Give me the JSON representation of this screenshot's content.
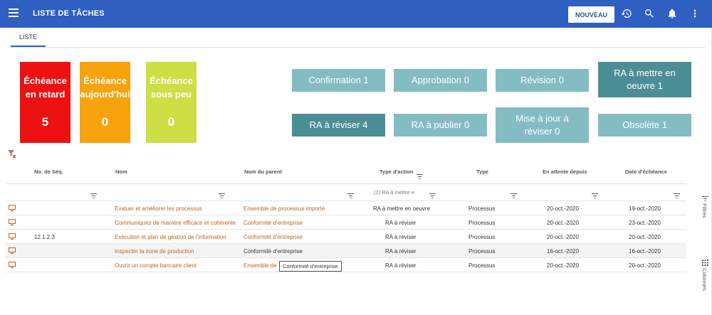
{
  "header": {
    "title": "LISTE DE TÂCHES",
    "new_label": "NOUVEAU"
  },
  "tabs": [
    {
      "label": "LISTE"
    }
  ],
  "tiles": [
    {
      "label": "Échéance en retard",
      "count": "5",
      "color": "#ee1111"
    },
    {
      "label": "Échéance aujourd'hui",
      "count": "0",
      "color": "#f8a20e"
    },
    {
      "label": "Échéance sous peu",
      "count": "0",
      "color": "#cede45"
    }
  ],
  "status_buttons": [
    {
      "label": "Confirmation 1",
      "color": "#84bcc4"
    },
    {
      "label": "Approbation 0",
      "color": "#84bcc4"
    },
    {
      "label": "Révision 0",
      "color": "#84bcc4"
    },
    {
      "label": "RA à mettre en oeuvre 1",
      "color": "#4c8e96"
    },
    {
      "label": "RA à réviser 4",
      "color": "#4c8e96"
    },
    {
      "label": "RA à publier 0",
      "color": "#84bcc4"
    },
    {
      "label": "Mise à jour à réviser 0",
      "color": "#84bcc4"
    },
    {
      "label": "Obsolète 1",
      "color": "#84bcc4"
    }
  ],
  "table": {
    "columns": [
      "No. de Séq.",
      "Nom",
      "Nom du parent",
      "Type d'action",
      "Type",
      "En attente depuis",
      "Date d'échéance"
    ],
    "filter_value": "(2) RA à mettre e",
    "rows": [
      {
        "seq": "",
        "name": "Évaluer et améliorer les processus",
        "parent": "Ensemble de processus importé",
        "action": "RA à mettre en oeuvre",
        "type": "Processus",
        "since": "20-oct.-2020",
        "due": "19-oct.-2020"
      },
      {
        "seq": "",
        "name": "Communiquez de manière efficace et cohérente",
        "parent": "Conformité d'entreprise",
        "action": "RA à réviser",
        "type": "Processus",
        "since": "20-oct.-2020",
        "due": "23-oct.-2020"
      },
      {
        "seq": "12.1.2.3",
        "name": "Exécution et plan de gestion de l'information",
        "parent": "Conformité d'entreprise",
        "action": "RA à réviser",
        "type": "Processus",
        "since": "20-oct.-2020",
        "due": "20-oct.-2020"
      },
      {
        "seq": "",
        "name": "Inspecter la zone de production",
        "parent": "Conformité d'entreprise",
        "action": "RA à réviser",
        "type": "Processus",
        "since": "16-oct.-2020",
        "due": "16-oct.-2020"
      },
      {
        "seq": "",
        "name": "Ouvrir un compte bancaire client",
        "parent": "Ensemble de",
        "action": "RA à réviser",
        "type": "Processus",
        "since": "20-oct.-2020",
        "due": "20-oct.-2020"
      }
    ]
  },
  "tooltip": "Conformité d'entreprise",
  "side_panel": {
    "filters": "Filtres",
    "columns": "Colonnes"
  },
  "icons": [
    "menu-icon",
    "history-icon",
    "search-icon",
    "bell-icon",
    "more-vert-icon",
    "filter-clear-icon",
    "filter-icon",
    "monitor-icon",
    "columns-icon"
  ]
}
